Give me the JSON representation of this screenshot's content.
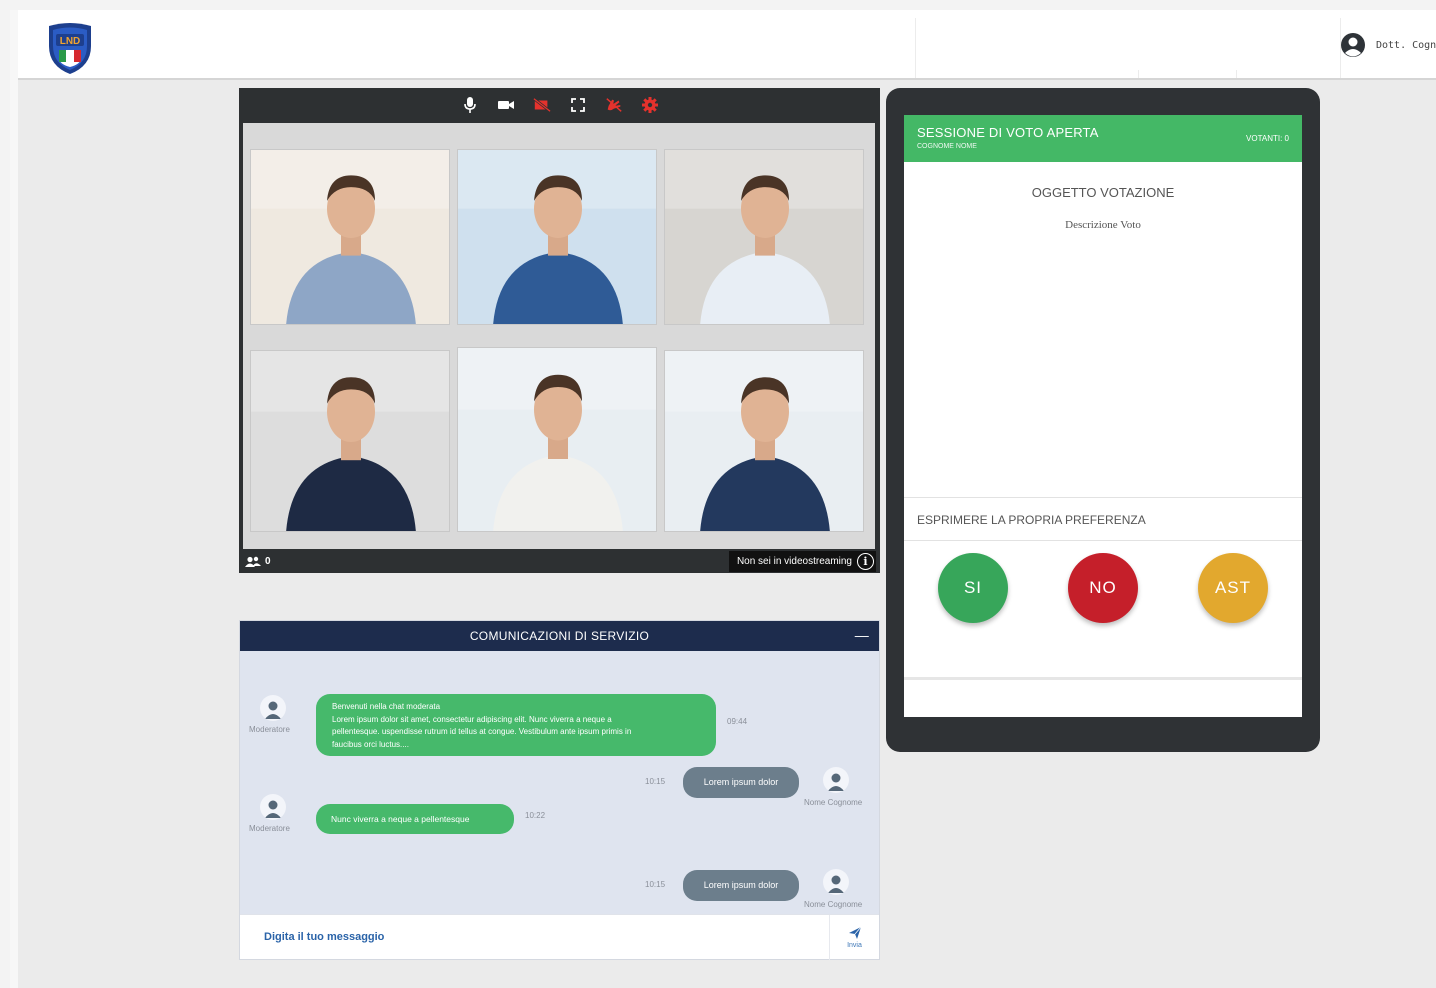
{
  "header": {
    "logo_text": "LND",
    "user_name": "Dott. Cognome"
  },
  "video": {
    "participants_count": "0",
    "streaming_status": "Non sei in videostreaming",
    "toolbar_icons": [
      "microphone-icon",
      "camera-icon",
      "video-off-icon",
      "fullscreen-icon",
      "hand-off-icon",
      "settings-icon"
    ],
    "muted_color": "#e5322d",
    "participants": [
      {
        "id": 1,
        "shirt": "#8ea6c6",
        "bg": "#efe9e0"
      },
      {
        "id": 2,
        "shirt": "#2f5b96",
        "bg": "#cfe0ee"
      },
      {
        "id": 3,
        "shirt": "#e8eef5",
        "bg": "#d7d5d1"
      },
      {
        "id": 4,
        "shirt": "#1e2a44",
        "bg": "#dddddd"
      },
      {
        "id": 5,
        "shirt": "#f1f1ee",
        "bg": "#e8eef2"
      },
      {
        "id": 6,
        "shirt": "#23395e",
        "bg": "#e9eef2"
      }
    ]
  },
  "chat": {
    "title": "COMUNICAZIONI DI SERVIZIO",
    "minimize_label": "—",
    "input_placeholder": "Digita il tuo messaggio",
    "send_label": "Invia",
    "messages": [
      {
        "author": "Moderatore",
        "lines": [
          "Benvenuti nella chat moderata",
          "Lorem ipsum dolor sit amet, consectetur adipiscing elit. Nunc viverra a neque a",
          "pellentesque. uspendisse rutrum id tellus at congue. Vestibulum ante ipsum primis in",
          "faucibus orci luctus...."
        ],
        "time": "09:44"
      },
      {
        "author": "Nome Cognome",
        "text": "Lorem ipsum dolor",
        "time": "10:15"
      },
      {
        "author": "Moderatore",
        "text": "Nunc viverra a neque a pellentesque",
        "time": "10:22"
      },
      {
        "author": "Nome Cognome",
        "text": "Lorem ipsum dolor",
        "time": "10:15"
      }
    ]
  },
  "vote": {
    "status": "SESSIONE DI VOTO APERTA",
    "name": "COGNOME NOME",
    "voters": "VOTANTI: 0",
    "subject": "OGGETTO VOTAZIONE",
    "description": "Descrizione Voto",
    "preference_label": "ESPRIMERE LA PROPRIA PREFERENZA",
    "options": [
      {
        "label": "SI",
        "color": "#37a65a"
      },
      {
        "label": "NO",
        "color": "#c51f2a"
      },
      {
        "label": "AST",
        "color": "#e2a82e"
      }
    ]
  },
  "colors": {
    "header_navy": "#1d2c4d",
    "vote_green": "#44b866",
    "link_blue": "#2a63a8"
  }
}
